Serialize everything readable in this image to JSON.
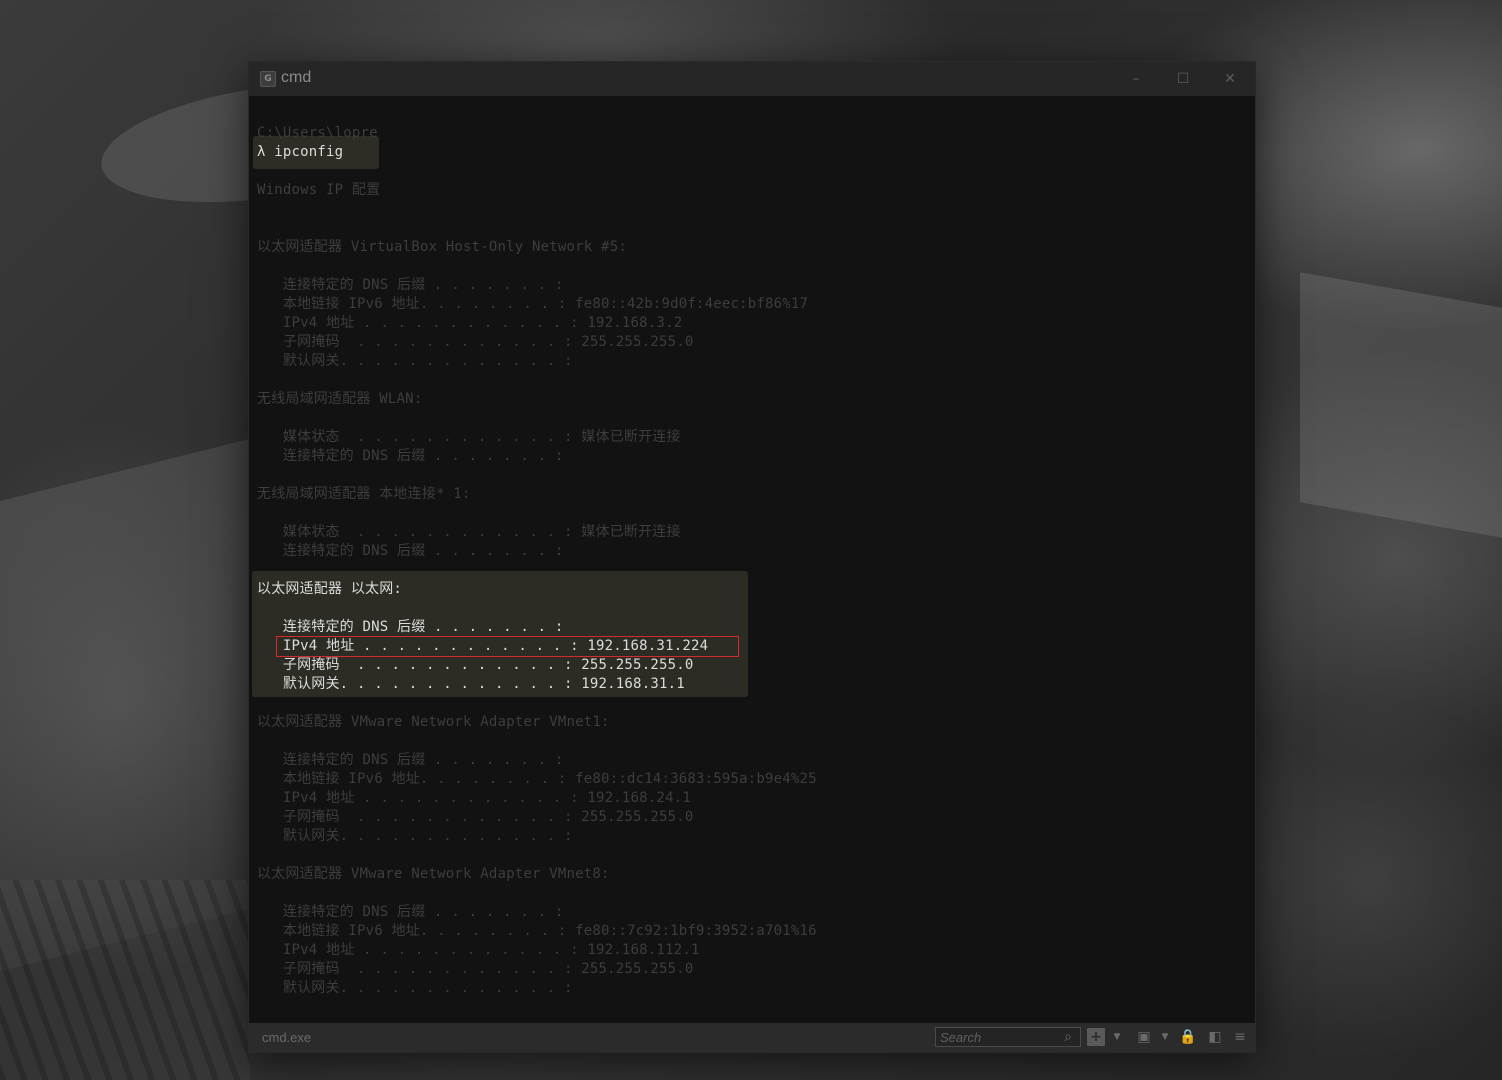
{
  "window": {
    "title": "cmd",
    "app_icon_glyph": "G"
  },
  "console": {
    "lines": [
      "C:\\Users\\lopre",
      "λ ipconfig",
      "",
      "Windows IP 配置",
      "",
      "",
      "以太网适配器 VirtualBox Host-Only Network #5:",
      "",
      "   连接特定的 DNS 后缀 . . . . . . . :",
      "   本地链接 IPv6 地址. . . . . . . . : fe80::42b:9d0f:4eec:bf86%17",
      "   IPv4 地址 . . . . . . . . . . . . : 192.168.3.2",
      "   子网掩码  . . . . . . . . . . . . : 255.255.255.0",
      "   默认网关. . . . . . . . . . . . . :",
      "",
      "无线局域网适配器 WLAN:",
      "",
      "   媒体状态  . . . . . . . . . . . . : 媒体已断开连接",
      "   连接特定的 DNS 后缀 . . . . . . . :",
      "",
      "无线局域网适配器 本地连接* 1:",
      "",
      "   媒体状态  . . . . . . . . . . . . : 媒体已断开连接",
      "   连接特定的 DNS 后缀 . . . . . . . :",
      "",
      "以太网适配器 以太网:",
      "",
      "   连接特定的 DNS 后缀 . . . . . . . :",
      "   IPv4 地址 . . . . . . . . . . . . : 192.168.31.224",
      "   子网掩码  . . . . . . . . . . . . : 255.255.255.0",
      "   默认网关. . . . . . . . . . . . . : 192.168.31.1",
      "",
      "以太网适配器 VMware Network Adapter VMnet1:",
      "",
      "   连接特定的 DNS 后缀 . . . . . . . :",
      "   本地链接 IPv6 地址. . . . . . . . : fe80::dc14:3683:595a:b9e4%25",
      "   IPv4 地址 . . . . . . . . . . . . : 192.168.24.1",
      "   子网掩码  . . . . . . . . . . . . : 255.255.255.0",
      "   默认网关. . . . . . . . . . . . . :",
      "",
      "以太网适配器 VMware Network Adapter VMnet8:",
      "",
      "   连接特定的 DNS 后缀 . . . . . . . :",
      "   本地链接 IPv6 地址. . . . . . . . : fe80::7c92:1bf9:3952:a701%16",
      "   IPv4 地址 . . . . . . . . . . . . : 192.168.112.1",
      "   子网掩码  . . . . . . . . . . . . : 255.255.255.0",
      "   默认网关. . . . . . . . . . . . . :"
    ],
    "bright_lines": [
      1,
      24,
      26,
      27,
      28,
      29
    ],
    "highlighted_line": 27,
    "colors": {
      "dim_text": "#3d3d3d",
      "bright_text": "#dcdcdc",
      "highlight_bg": "#2c2c24",
      "red_box": "#d42a2a"
    }
  },
  "statusbar": {
    "process": "cmd.exe",
    "search_placeholder": "Search",
    "icons": [
      "search-icon",
      "plus-icon",
      "chevron-down-icon",
      "view-icon",
      "chevron-down-icon",
      "lock-icon",
      "split-pane-icon",
      "menu-icon"
    ]
  }
}
